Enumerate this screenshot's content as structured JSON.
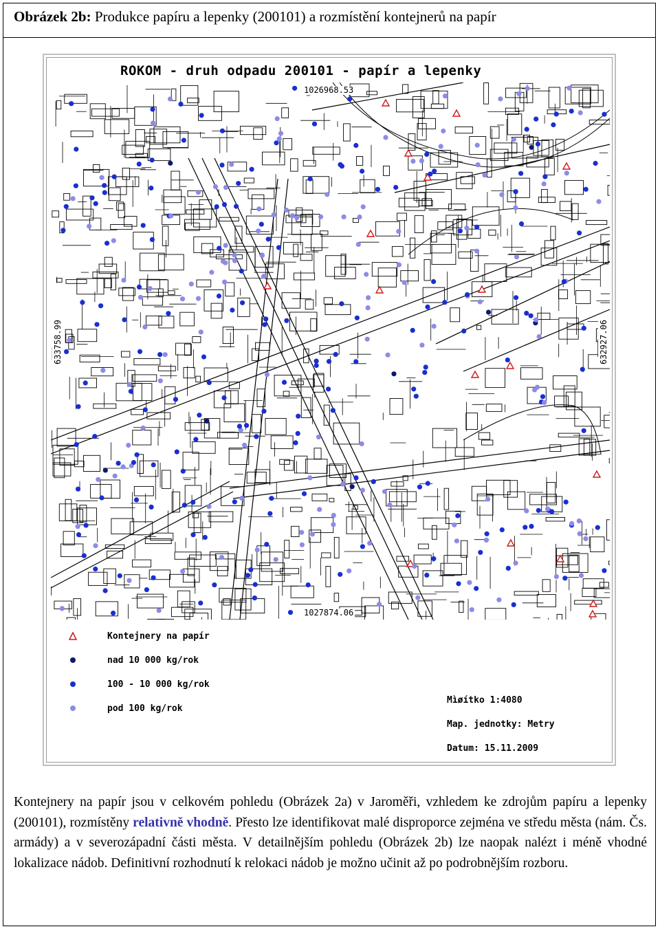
{
  "heading": {
    "label": "Obrázek 2b:",
    "text": " Produkce papíru a lepenky (200101) a rozmístění kontejnerů na papír"
  },
  "map": {
    "title": "ROKOM - druh odpadu 200101 - papír a lepenky",
    "coord_top": "1026968.53",
    "coord_bottom": "1027874.06",
    "coord_left": "633758.99",
    "coord_right": "632927.06",
    "colors": {
      "container_marker": "#d01818",
      "over_10000": "#0a1a6e",
      "range_100_10000": "#1a2fd0",
      "under_100": "#8c8ce6",
      "streets": "#000000"
    }
  },
  "legend": {
    "items": [
      {
        "label": "Kontejnery na papír",
        "symbol": "triangle-outline",
        "color": "#d01818"
      },
      {
        "label": "nad 10 000 kg/rok",
        "symbol": "dot",
        "color": "#0a1a6e"
      },
      {
        "label": "100 - 10 000 kg/rok",
        "symbol": "dot",
        "color": "#1a2fd0"
      },
      {
        "label": "pod 100 kg/rok",
        "symbol": "dot",
        "color": "#8c8ce6"
      }
    ],
    "scale": "Mìøítko 1:4080",
    "units": "Map. jednotky: Metry",
    "date": "Datum: 15.11.2009"
  },
  "body": {
    "part1": "Kontejnery na papír jsou v celkovém pohledu (Obrázek 2a) v Jaroměři, vzhledem ke zdrojům papíru a lepenky (200101), rozmístěny ",
    "highlight": "relativně vhodně",
    "part2": ". Přesto lze identifikovat malé disproporce zejména ve středu města (nám. Čs. armády) a v severozápadní části města. V detailnějším pohledu (Obrázek 2b) lze naopak nalézt i méně vhodné lokalizace nádob. Definitivní rozhodnutí k relokaci nádob je možno učinit až po podrobnějším rozboru."
  }
}
